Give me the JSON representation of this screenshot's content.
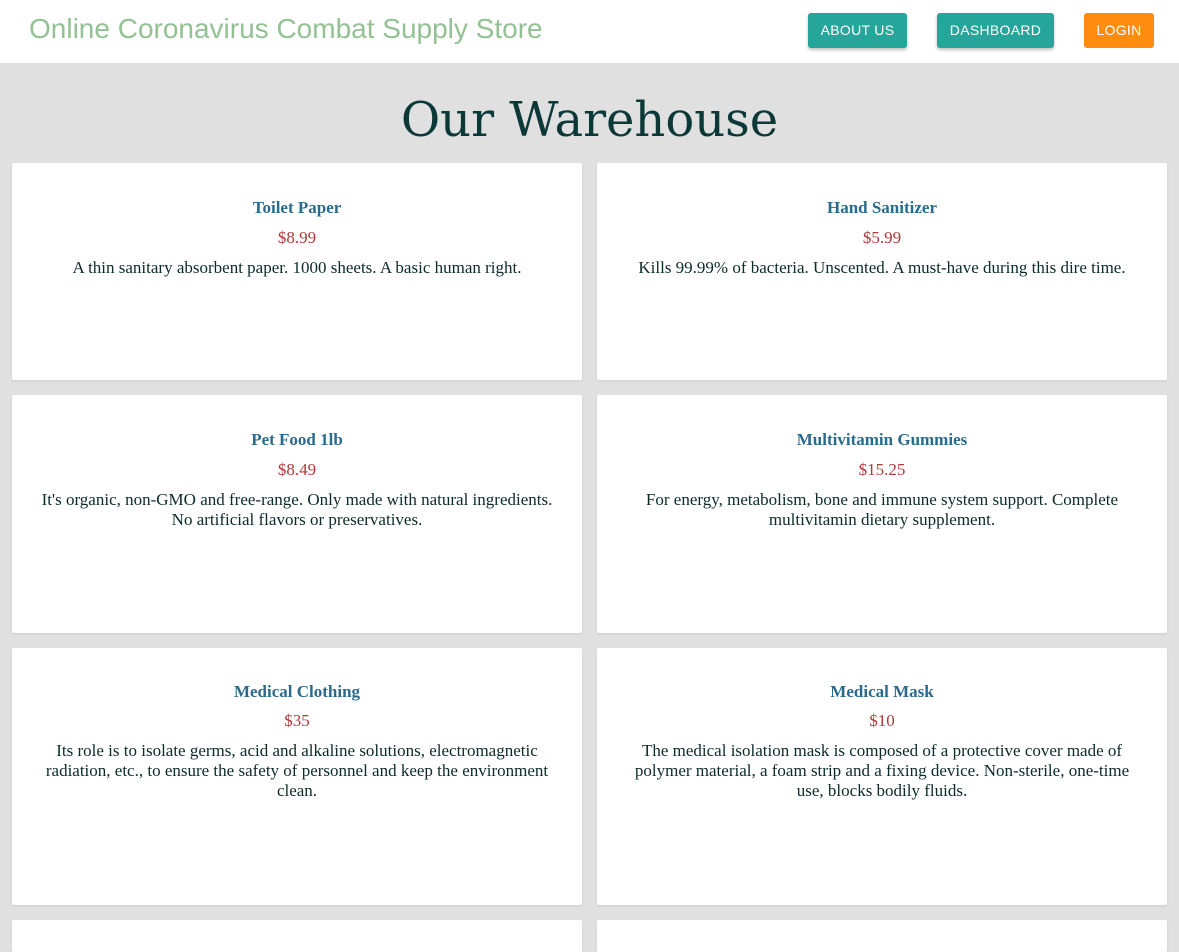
{
  "header": {
    "brand": "Online Coronavirus Combat Supply Store",
    "nav": {
      "about": "ABOUT US",
      "dashboard": "DASHBOARD",
      "login": "LOGIN"
    }
  },
  "main": {
    "title": "Our Warehouse",
    "products": [
      {
        "name": "Toilet Paper",
        "price": "$8.99",
        "description": "A thin sanitary absorbent paper. 1000 sheets. A basic human right."
      },
      {
        "name": "Hand Sanitizer",
        "price": "$5.99",
        "description": "Kills 99.99% of bacteria. Unscented. A must-have during this dire time."
      },
      {
        "name": "Pet Food 1lb",
        "price": "$8.49",
        "description": "It's organic, non-GMO and free-range. Only made with natural ingredients. No artificial flavors or preservatives."
      },
      {
        "name": "Multivitamin Gummies",
        "price": "$15.25",
        "description": "For energy, metabolism, bone and immune system support. Complete multivitamin dietary supplement."
      },
      {
        "name": "Medical Clothing",
        "price": "$35",
        "description": "Its role is to isolate germs, acid and alkaline solutions, electromagnetic radiation, etc., to ensure the safety of personnel and keep the environment clean."
      },
      {
        "name": "Medical Mask",
        "price": "$10",
        "description": "The medical isolation mask is composed of a protective cover made of polymer material, a foam strip and a fixing device. Non-sterile, one-time use, blocks bodily fluids."
      }
    ]
  },
  "colors": {
    "brand_text": "#94c194",
    "nav_button": "#26a69a",
    "login_button": "#ff8c0f",
    "page_background": "#e0e0e0",
    "title_text": "#0c3838",
    "product_name": "#2b6a8c",
    "product_price": "#b0383a"
  }
}
